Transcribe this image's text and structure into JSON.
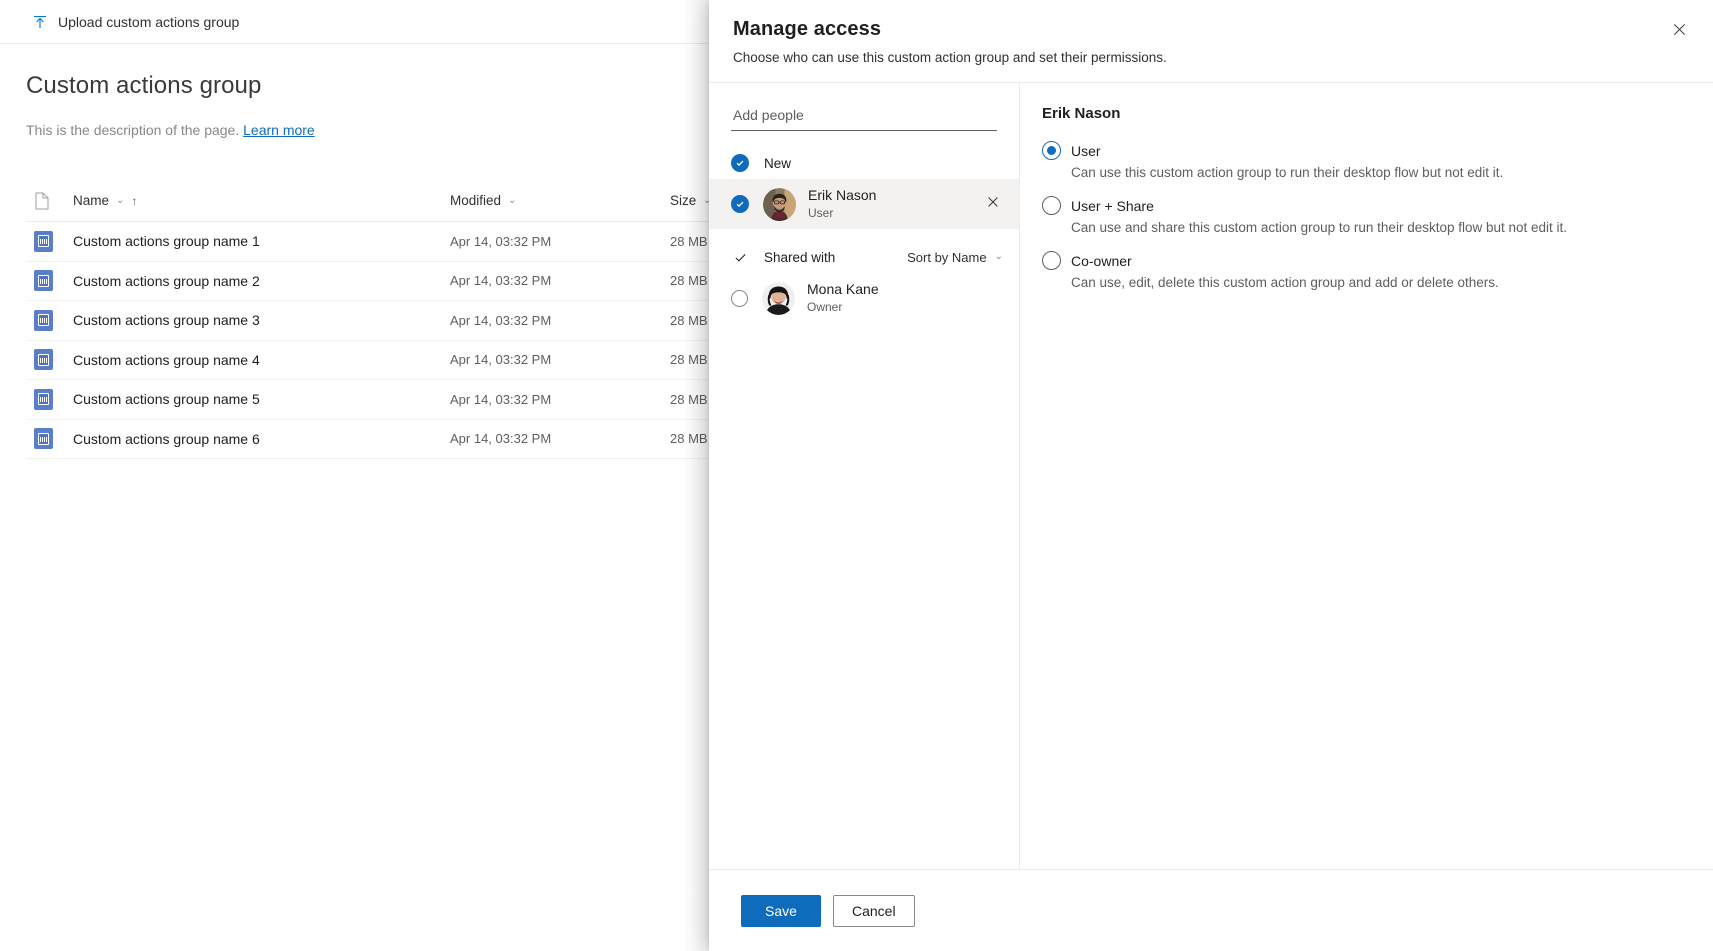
{
  "background": {
    "command_bar": {
      "upload_label": "Upload custom actions group",
      "upload_icon": "upload-arrow-icon"
    },
    "page_title": "Custom actions group",
    "page_description": "This is the description of the page.",
    "learn_more": "Learn more",
    "table": {
      "columns": [
        "Name",
        "Modified",
        "Size"
      ],
      "sort_indicator": "↑",
      "rows": [
        {
          "name": "Custom actions group name 1",
          "modified": "Apr 14, 03:32 PM",
          "size": "28 MB"
        },
        {
          "name": "Custom actions group name 2",
          "modified": "Apr 14, 03:32 PM",
          "size": "28 MB"
        },
        {
          "name": "Custom actions group name 3",
          "modified": "Apr 14, 03:32 PM",
          "size": "28 MB"
        },
        {
          "name": "Custom actions group name 4",
          "modified": "Apr 14, 03:32 PM",
          "size": "28 MB"
        },
        {
          "name": "Custom actions group name 5",
          "modified": "Apr 14, 03:32 PM",
          "size": "28 MB"
        },
        {
          "name": "Custom actions group name 6",
          "modified": "Apr 14, 03:32 PM",
          "size": "28 MB"
        }
      ]
    }
  },
  "panel": {
    "title": "Manage access",
    "subtitle": "Choose who can use this custom action group and set their permissions.",
    "close_icon": "close-icon",
    "people": {
      "input_placeholder": "Add people",
      "input_value": "",
      "new_group_label": "New",
      "shared_group_label": "Shared with",
      "sort_label": "Sort by Name",
      "new_members": [
        {
          "name": "Erik Nason",
          "role": "User",
          "selected": true,
          "remove_icon": "close-icon"
        }
      ],
      "shared_members": [
        {
          "name": "Mona Kane",
          "role": "Owner",
          "selected": false
        }
      ]
    },
    "permissions": {
      "heading": "Erik Nason",
      "selected": "User",
      "options": [
        {
          "label": "User",
          "description": "Can use this custom action group to run their desktop flow but not edit it.",
          "checked": true
        },
        {
          "label": "User + Share",
          "description": "Can use and share this custom action group to run their desktop flow but not edit it.",
          "checked": false
        },
        {
          "label": "Co-owner",
          "description": "Can use, edit, delete this custom action group and add or delete others.",
          "checked": false
        }
      ]
    },
    "footer": {
      "save_label": "Save",
      "cancel_label": "Cancel"
    }
  },
  "colors": {
    "accent": "#0f6cbd",
    "link": "#0f6cbd",
    "tile": "#5b7fc7"
  }
}
